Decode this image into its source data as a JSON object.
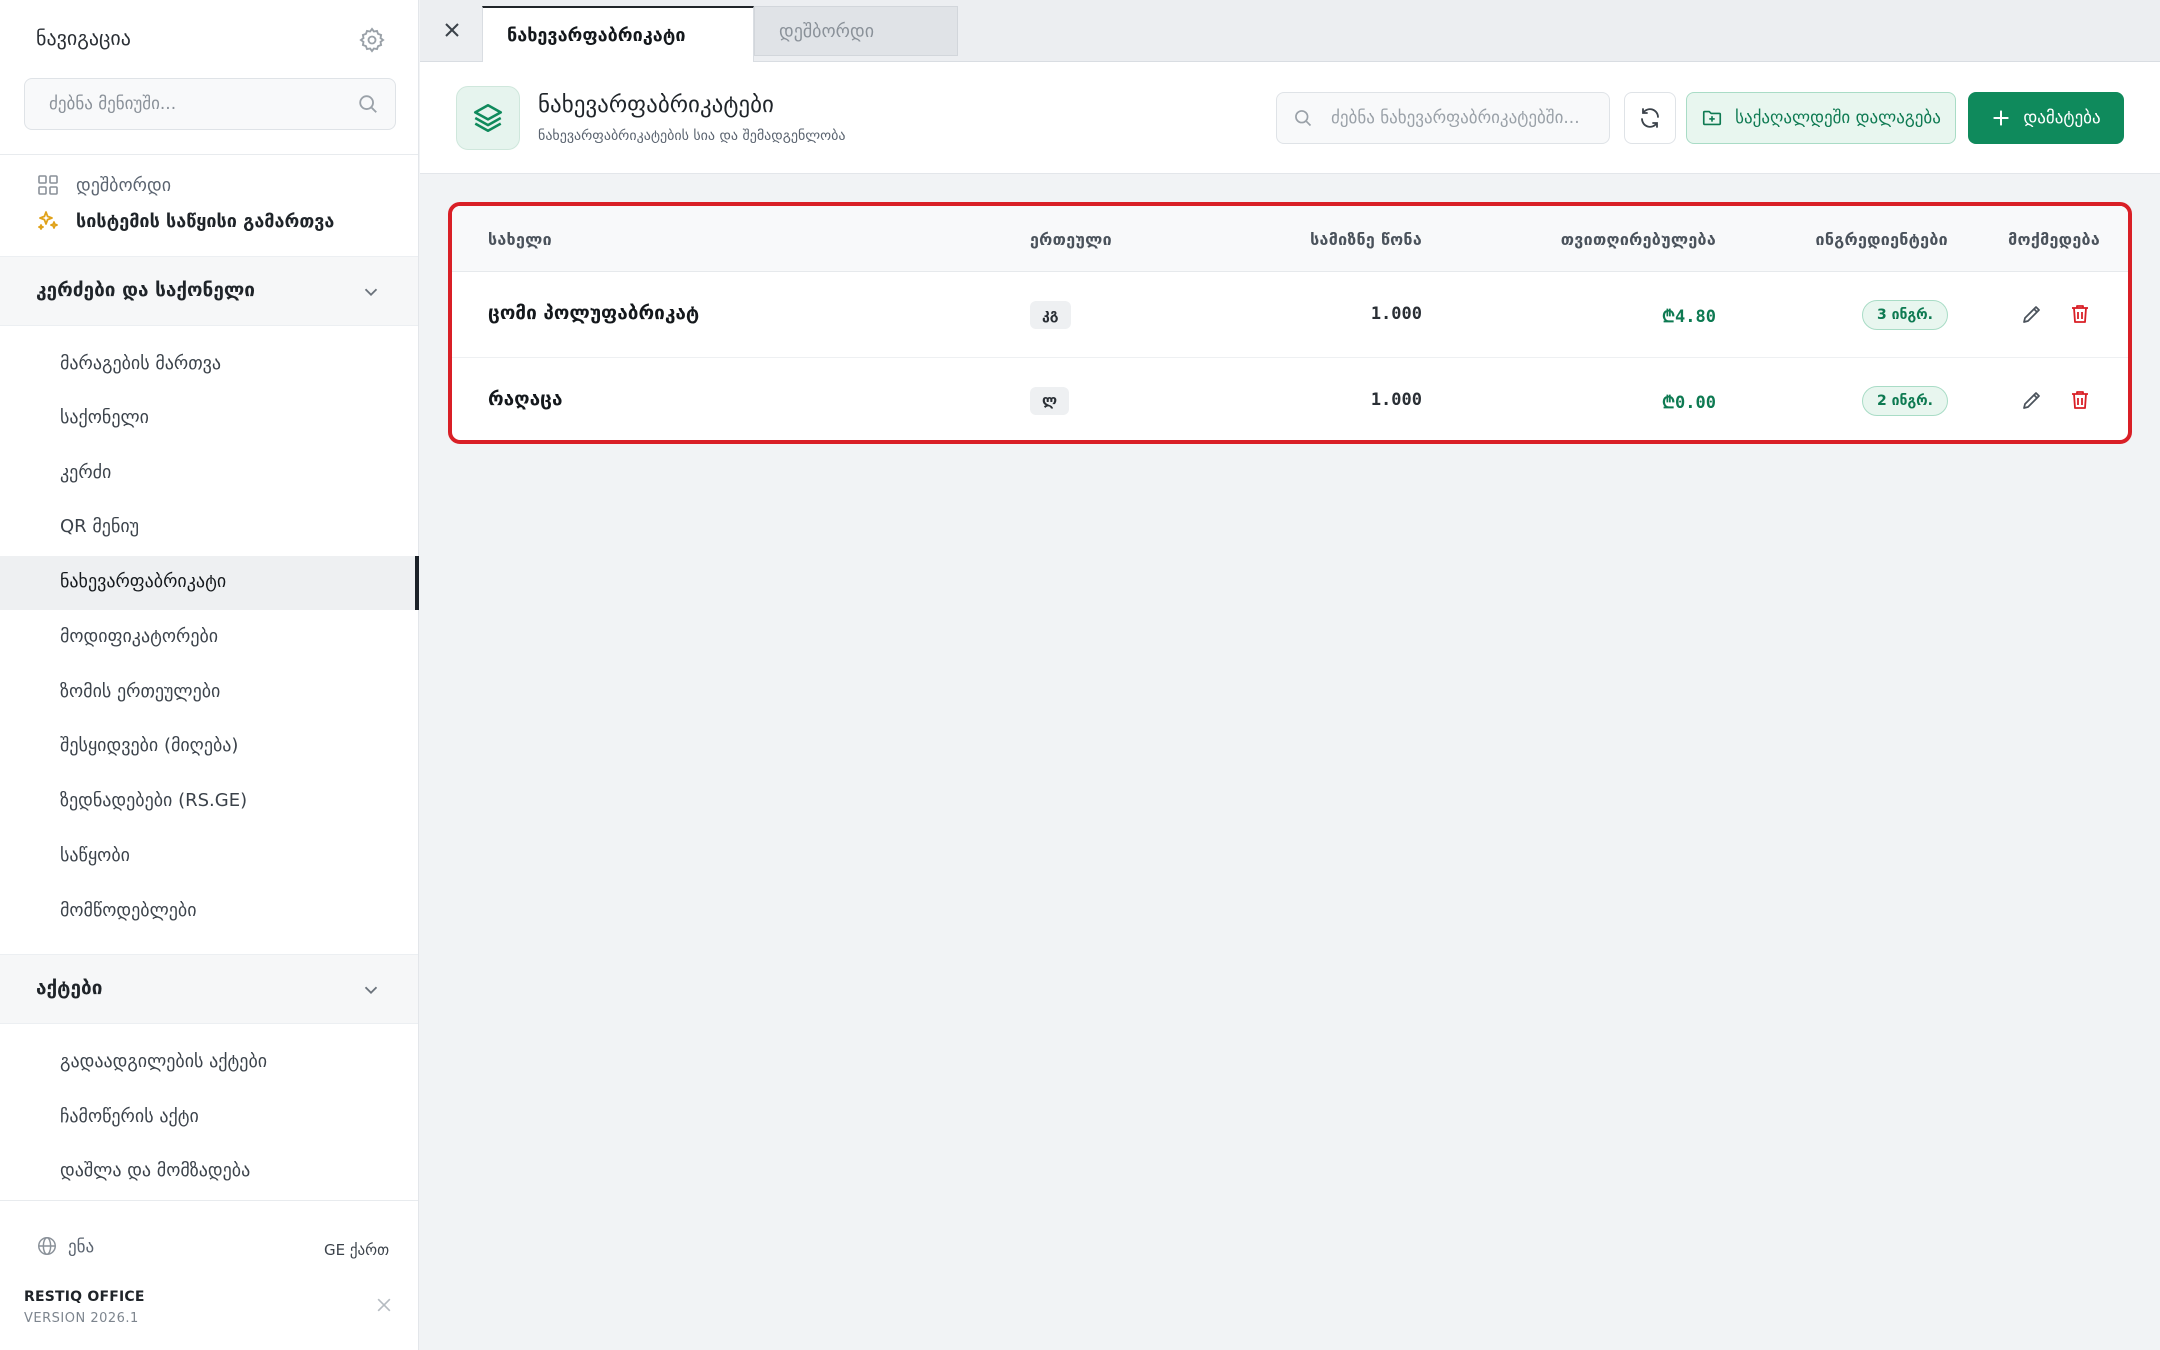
{
  "sidebar": {
    "title": "ნავიგაცია",
    "search_placeholder": "ძებნა მენიუში...",
    "top_items": [
      {
        "label": "დეშბორდი",
        "icon": "grid-icon"
      },
      {
        "label": "სისტემის საწყისი გამართვა",
        "icon": "sparkles-icon"
      }
    ],
    "groups": [
      {
        "label": "კერძები და საქონელი",
        "items": [
          {
            "label": "მარაგების მართვა"
          },
          {
            "label": "საქონელი"
          },
          {
            "label": "კერძი"
          },
          {
            "label": "QR მენიუ"
          },
          {
            "label": "ნახევარფაბრიკატი",
            "active": true
          },
          {
            "label": "მოდიფიკატორები"
          },
          {
            "label": "ზომის ერთეულები"
          },
          {
            "label": "შესყიდვები (მიღება)"
          },
          {
            "label": "ზედნადებები (RS.GE)"
          },
          {
            "label": "საწყობი"
          },
          {
            "label": "მომწოდებლები"
          }
        ]
      },
      {
        "label": "აქტები",
        "items": [
          {
            "label": "გადაადგილების აქტები"
          },
          {
            "label": "ჩამოწერის აქტი"
          },
          {
            "label": "დაშლა და მომზადება"
          }
        ]
      }
    ],
    "footer": {
      "lang_label": "ენა",
      "lang_value": "GE ქართ",
      "brand": "RESTIQ OFFICE",
      "version": "VERSION 2026.1"
    }
  },
  "tabs": [
    {
      "label": "ნახევარფაბრიკატი",
      "active": true
    },
    {
      "label": "დეშბორდი",
      "active": false
    }
  ],
  "page": {
    "title": "ნახევარფაბრიკატები",
    "subtitle": "ნახევარფაბრიკატების სია და შემადგენლობა",
    "search_placeholder": "ძებნა ნახევარფაბრიკატებში...",
    "folder_button": "საქაღალდეში დალაგება",
    "add_button": "დამატება"
  },
  "table": {
    "columns": [
      "სახელი",
      "ერთეული",
      "სამიზნე წონა",
      "თვითღირებულება",
      "ინგრედიენტები",
      "მოქმედება"
    ],
    "rows": [
      {
        "name": "ცომი პოლუფაბრიკატ",
        "unit": "კგ",
        "target_weight": "1.000",
        "cost": "₾4.80",
        "ingredients": "3 ინგრ."
      },
      {
        "name": "რაღაცა",
        "unit": "ლ",
        "target_weight": "1.000",
        "cost": "₾0.00",
        "ingredients": "2 ინგრ."
      }
    ]
  },
  "colors": {
    "accent": "#0f8a5c",
    "danger": "#d91f26",
    "highlight_border": "#d91f26"
  }
}
